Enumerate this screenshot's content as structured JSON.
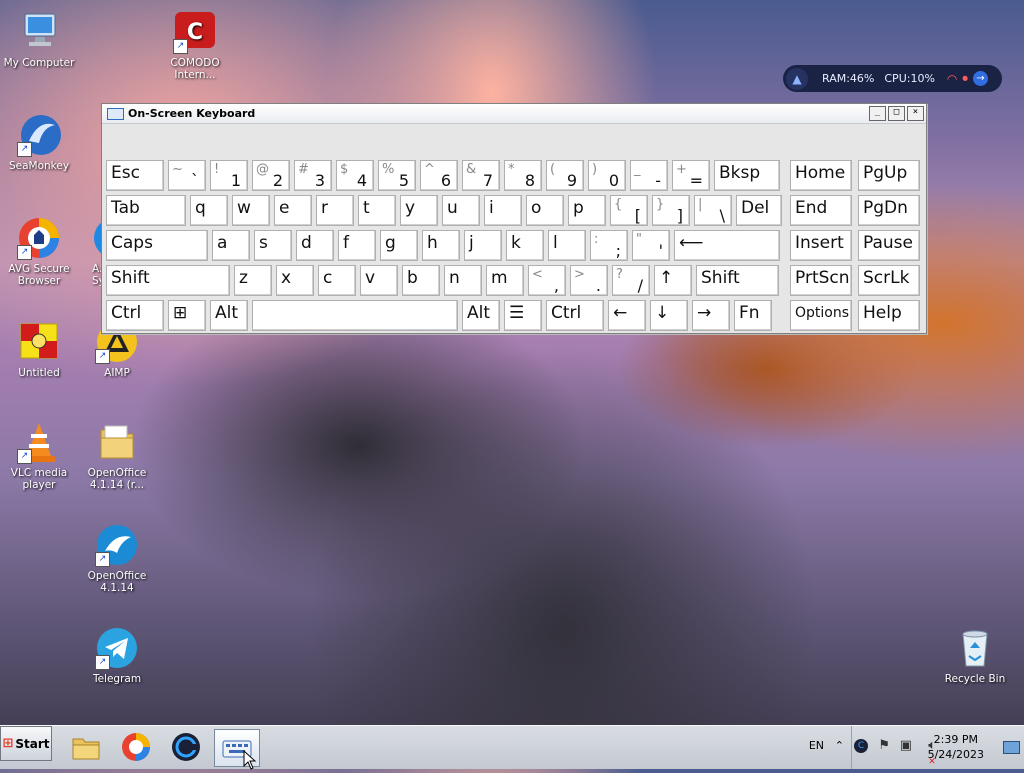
{
  "desktop": {
    "icons": [
      {
        "label": "My Computer"
      },
      {
        "label": "COMODO Intern..."
      },
      {
        "label": "SeaMonkey"
      },
      {
        "label": "AVG Secure Browser"
      },
      {
        "label": "A... Sy..."
      },
      {
        "label": "Untitled"
      },
      {
        "label": "AIMP"
      },
      {
        "label": "VLC media player"
      },
      {
        "label": "OpenOffice 4.1.14 (r..."
      },
      {
        "label": "OpenOffice 4.1.14"
      },
      {
        "label": "Telegram"
      },
      {
        "label": "Recycle Bin"
      }
    ]
  },
  "sysmon": {
    "ram": "RAM:46%",
    "cpu": "CPU:10%"
  },
  "osk": {
    "title": "On-Screen Keyboard",
    "rows": [
      [
        {
          "label": "Esc"
        },
        {
          "shift": "~",
          "main": "`"
        },
        {
          "shift": "!",
          "main": "1"
        },
        {
          "shift": "@",
          "main": "2"
        },
        {
          "shift": "#",
          "main": "3"
        },
        {
          "shift": "$",
          "main": "4"
        },
        {
          "shift": "%",
          "main": "5"
        },
        {
          "shift": "^",
          "main": "6"
        },
        {
          "shift": "&",
          "main": "7"
        },
        {
          "shift": "*",
          "main": "8"
        },
        {
          "shift": "(",
          "main": "9"
        },
        {
          "shift": ")",
          "main": "0"
        },
        {
          "shift": "_",
          "main": "-"
        },
        {
          "shift": "+",
          "main": "="
        },
        {
          "label": "Bksp"
        },
        {
          "label": "Home"
        },
        {
          "label": "PgUp"
        }
      ],
      [
        {
          "label": "Tab"
        },
        {
          "label": "q"
        },
        {
          "label": "w"
        },
        {
          "label": "e"
        },
        {
          "label": "r"
        },
        {
          "label": "t"
        },
        {
          "label": "y"
        },
        {
          "label": "u"
        },
        {
          "label": "i"
        },
        {
          "label": "o"
        },
        {
          "label": "p"
        },
        {
          "shift": "{",
          "main": "["
        },
        {
          "shift": "}",
          "main": "]"
        },
        {
          "shift": "|",
          "main": "\\"
        },
        {
          "label": "Del"
        },
        {
          "label": "End"
        },
        {
          "label": "PgDn"
        }
      ],
      [
        {
          "label": "Caps"
        },
        {
          "label": "a"
        },
        {
          "label": "s"
        },
        {
          "label": "d"
        },
        {
          "label": "f"
        },
        {
          "label": "g"
        },
        {
          "label": "h"
        },
        {
          "label": "j"
        },
        {
          "label": "k"
        },
        {
          "label": "l"
        },
        {
          "shift": ":",
          "main": ";"
        },
        {
          "shift": "\"",
          "main": "'"
        },
        {
          "label": "⟵"
        },
        {
          "label": "Insert"
        },
        {
          "label": "Pause"
        }
      ],
      [
        {
          "label": "Shift"
        },
        {
          "label": "z"
        },
        {
          "label": "x"
        },
        {
          "label": "c"
        },
        {
          "label": "v"
        },
        {
          "label": "b"
        },
        {
          "label": "n"
        },
        {
          "label": "m"
        },
        {
          "shift": "<",
          "main": ","
        },
        {
          "shift": ">",
          "main": "."
        },
        {
          "shift": "?",
          "main": "/"
        },
        {
          "label": "↑"
        },
        {
          "label": "Shift"
        },
        {
          "label": "PrtScn"
        },
        {
          "label": "ScrLk"
        }
      ],
      [
        {
          "label": "Ctrl"
        },
        {
          "label": "⊞"
        },
        {
          "label": "Alt"
        },
        {
          "label": ""
        },
        {
          "label": "Alt"
        },
        {
          "label": "☰"
        },
        {
          "label": "Ctrl"
        },
        {
          "label": "←"
        },
        {
          "label": "↓"
        },
        {
          "label": "→"
        },
        {
          "label": "Fn"
        },
        {
          "label": "Options"
        },
        {
          "label": "Help"
        }
      ]
    ]
  },
  "taskbar": {
    "start_label": "Start",
    "lang": "EN",
    "time": "2:39 PM",
    "date": "5/24/2023"
  }
}
